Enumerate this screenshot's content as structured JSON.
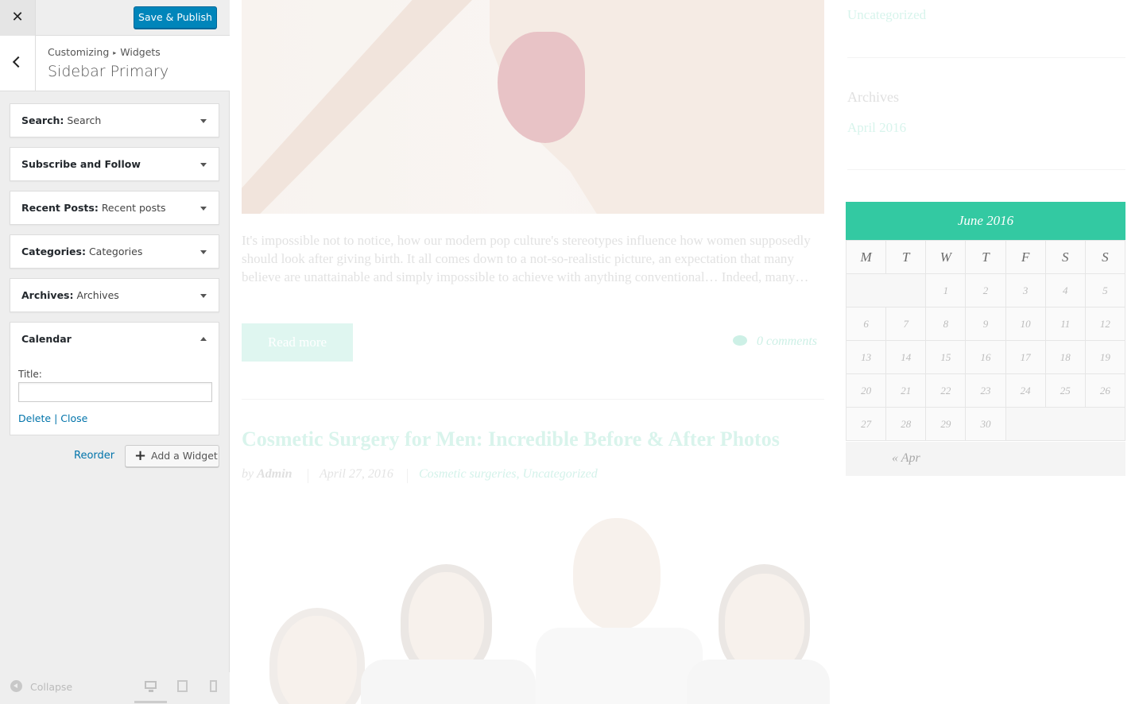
{
  "customizer": {
    "close_icon": "✕",
    "publish_label": "Save & Publish",
    "breadcrumb": {
      "root": "Customizing",
      "separator": "▸",
      "section": "Widgets"
    },
    "section_title": "Sidebar Primary",
    "widgets": [
      {
        "type": "Search:",
        "title": "Search"
      },
      {
        "type": "Subscribe and Follow",
        "title": ""
      },
      {
        "type": "Recent Posts:",
        "title": "Recent posts"
      },
      {
        "type": "Categories:",
        "title": "Categories"
      },
      {
        "type": "Archives:",
        "title": "Archives"
      },
      {
        "type": "Calendar",
        "title": ""
      }
    ],
    "calendar_form": {
      "title_label": "Title:",
      "title_value": "",
      "delete_label": "Delete",
      "link_separator": "|",
      "close_label": "Close"
    },
    "reorder_label": "Reorder",
    "add_widget_label": "Add a Widget",
    "collapse_label": "Collapse",
    "devices": [
      "desktop-icon",
      "tablet-icon",
      "mobile-icon"
    ]
  },
  "preview": {
    "excerpt": "It's impossible not to notice, how our modern pop culture's stereotypes influence how women supposedly should look after giving birth. It all comes down to a not-so-realistic picture, an expectation that many believe are unattainable and simply impossible to achieve with anything conventional… Indeed, many…",
    "read_more": "Read more",
    "comments": "0 comments",
    "post_title": "Cosmetic Surgery for Men: Incredible Before & After Photos",
    "meta": {
      "by": "by",
      "author": "Admin",
      "date": "April 27, 2016",
      "categories": "Cosmetic surgeries, Uncategorized"
    },
    "sidebar": {
      "categories_link": "Uncategorized",
      "archives_title": "Archives",
      "archives_link": "April 2016",
      "calendar": {
        "caption": "June 2016",
        "weekdays": [
          "M",
          "T",
          "W",
          "T",
          "F",
          "S",
          "S"
        ],
        "weeks": [
          [
            "",
            "",
            "1",
            "2",
            "3",
            "4",
            "5"
          ],
          [
            "6",
            "7",
            "8",
            "9",
            "10",
            "11",
            "12"
          ],
          [
            "13",
            "14",
            "15",
            "16",
            "17",
            "18",
            "19"
          ],
          [
            "20",
            "21",
            "22",
            "23",
            "24",
            "25",
            "26"
          ],
          [
            "27",
            "28",
            "29",
            "30",
            "",
            "",
            ""
          ]
        ],
        "prev": "« Apr"
      }
    }
  },
  "colors": {
    "accent": "#33c9a2",
    "wp_blue": "#0085ba",
    "link": "#0073aa"
  }
}
